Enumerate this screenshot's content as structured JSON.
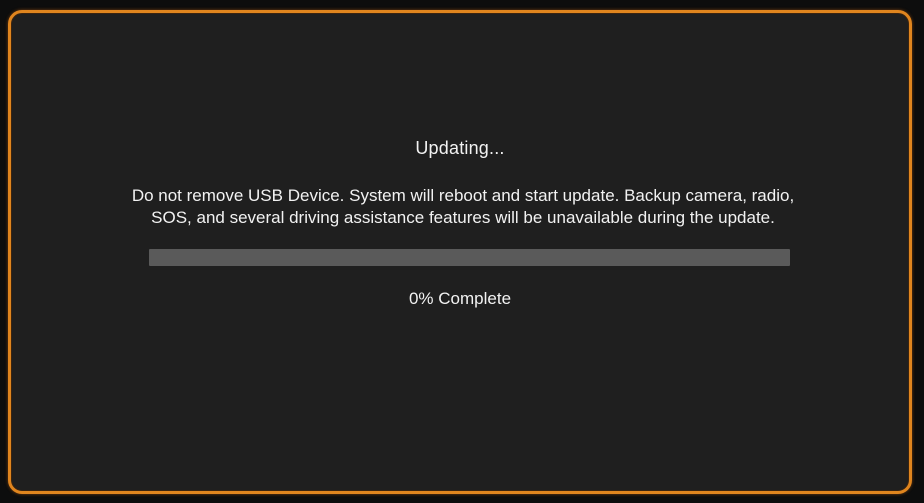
{
  "dialog": {
    "title": "Updating...",
    "message_line1": "Do not remove USB Device. System will reboot and start update. Backup camera, radio,",
    "message_line2": "SOS, and several driving assistance features will be unavailable during the update.",
    "progress_percent": 0,
    "status_text": "0% Complete"
  },
  "colors": {
    "border_accent": "#e0851e",
    "screen_background": "#1f1f1f",
    "text": "#f2f2f2",
    "progress_track": "#5a5a5a"
  }
}
